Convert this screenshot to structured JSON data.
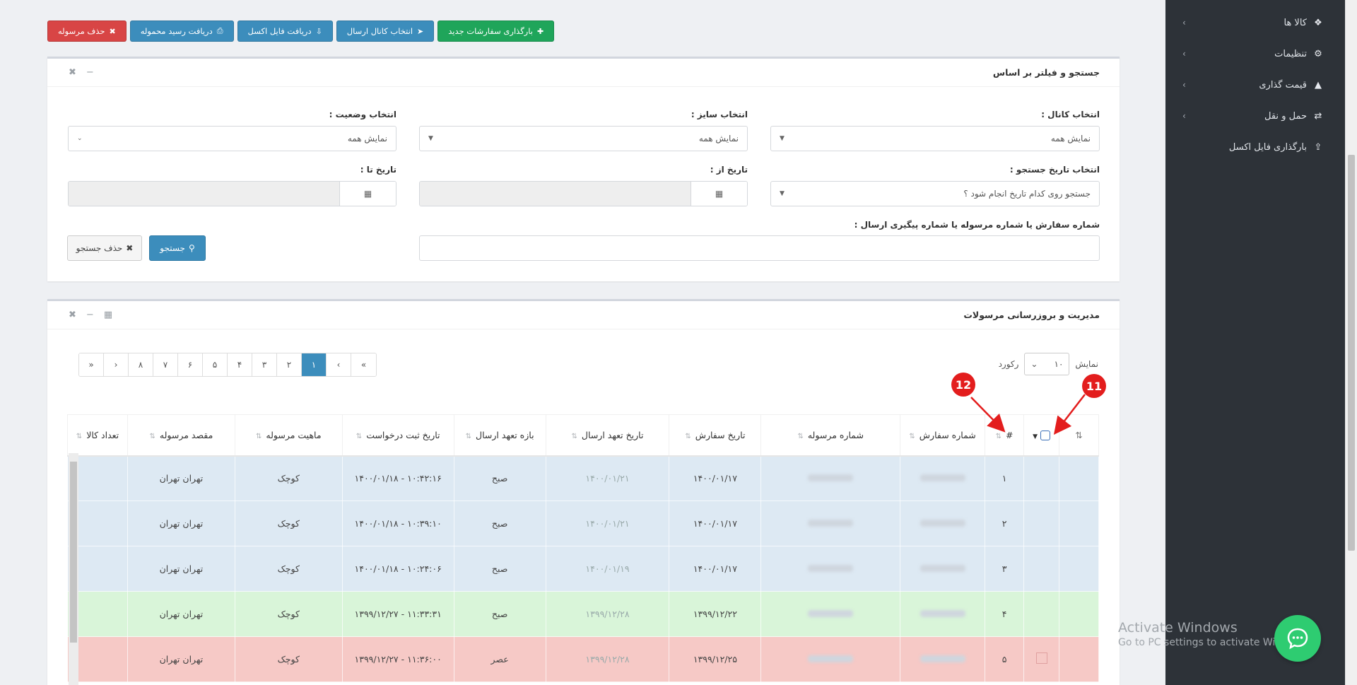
{
  "toolbar": {
    "delete_label": "حذف مرسوله",
    "receipt_label": "دریافت رسید محموله",
    "excel_label": "دریافت فایل اکسل",
    "channel_label": "انتخاب کانال ارسال",
    "upload_orders_label": "بارگذاری سفارشات جدید"
  },
  "sidebar": {
    "items": [
      {
        "label": "کالا ها",
        "icon": "cubes-icon"
      },
      {
        "label": "تنظیمات",
        "icon": "gear-icon"
      },
      {
        "label": "قیمت گذاری",
        "icon": "area-chart-icon"
      },
      {
        "label": "حمل و نقل",
        "icon": "exchange-icon"
      },
      {
        "label": "بارگذاری فایل اکسل",
        "icon": "upload-icon"
      }
    ]
  },
  "filter": {
    "title": "جستجو و فیلتر بر اساس",
    "channel_label": "انتخاب کانال :",
    "channel_value": "نمایش همه",
    "size_label": "انتخاب سایز :",
    "size_value": "نمایش همه",
    "status_label": "انتخاب وضعیت :",
    "status_value": "نمایش همه",
    "date_type_label": "انتخاب تاریخ جستجو :",
    "date_type_value": "جستجو روی کدام تاریخ انجام شود ؟",
    "date_from_label": "تاریخ از :",
    "date_to_label": "تاریخ تا :",
    "order_search_label": "شماره سفارش یا شماره مرسوله یا شماره پیگیری ارسال :",
    "search_button": "جستجو",
    "clear_button": "حذف جستجو"
  },
  "shipments": {
    "title": "مدیریت و بروزرسانی مرسولات",
    "show_label": "نمایش",
    "record_label": "رکورد",
    "page_size": "۱۰",
    "pages": [
      "»",
      "›",
      "۸",
      "۷",
      "۶",
      "۵",
      "۴",
      "۳",
      "۲",
      "۱",
      "‹",
      "«"
    ],
    "active_page": "۱",
    "columns": {
      "count": "تعداد کالا",
      "destination": "مقصد مرسوله",
      "nature": "ماهیت مرسوله",
      "request_date": "تاریخ ثبت درخواست",
      "send_window": "بازه تعهد ارسال",
      "commit_date": "تاریخ تعهد ارسال",
      "order_date": "تاریخ سفارش",
      "shipment_no": "شماره مرسوله",
      "order_no": "شماره سفارش",
      "index": "#"
    },
    "rows": [
      {
        "status": "blue",
        "destination": "تهران تهران",
        "nature": "کوچک",
        "request_date": "۱۴۰۰/۰۱/۱۸ - ۱۰:۴۲:۱۶",
        "send_window": "صبح",
        "commit_date": "۱۴۰۰/۰۱/۲۱",
        "order_date": "۱۴۰۰/۰۱/۱۷",
        "index": "۱"
      },
      {
        "status": "blue",
        "destination": "تهران تهران",
        "nature": "کوچک",
        "request_date": "۱۴۰۰/۰۱/۱۸ - ۱۰:۳۹:۱۰",
        "send_window": "صبح",
        "commit_date": "۱۴۰۰/۰۱/۲۱",
        "order_date": "۱۴۰۰/۰۱/۱۷",
        "index": "۲"
      },
      {
        "status": "blue",
        "destination": "تهران تهران",
        "nature": "کوچک",
        "request_date": "۱۴۰۰/۰۱/۱۸ - ۱۰:۲۴:۰۶",
        "send_window": "صبح",
        "commit_date": "۱۴۰۰/۰۱/۱۹",
        "order_date": "۱۴۰۰/۰۱/۱۷",
        "index": "۳"
      },
      {
        "status": "green",
        "destination": "تهران تهران",
        "nature": "کوچک",
        "request_date": "۱۳۹۹/۱۲/۲۷ - ۱۱:۳۳:۳۱",
        "send_window": "صبح",
        "commit_date": "۱۳۹۹/۱۲/۲۸",
        "order_date": "۱۳۹۹/۱۲/۲۲",
        "index": "۴"
      },
      {
        "status": "red",
        "destination": "تهران تهران",
        "nature": "کوچک",
        "request_date": "۱۳۹۹/۱۲/۲۷ - ۱۱:۳۶:۰۰",
        "send_window": "عصر",
        "commit_date": "۱۳۹۹/۱۲/۲۸",
        "order_date": "۱۳۹۹/۱۲/۲۵",
        "index": "۵"
      }
    ]
  },
  "annotations": {
    "a11": "11",
    "a12": "12"
  },
  "watermark": {
    "line1": "Activate Windows",
    "line2": "Go to PC settings to activate Windows."
  },
  "colors": {
    "sidebar": "#2d3238",
    "primary": "#3c8dbc",
    "success": "#1fa55a",
    "danger": "#d84545",
    "row_blue": "#dde9f3",
    "row_green": "#d9f5d9",
    "row_red": "#f6c9c6",
    "annotation": "#e31d1d"
  }
}
